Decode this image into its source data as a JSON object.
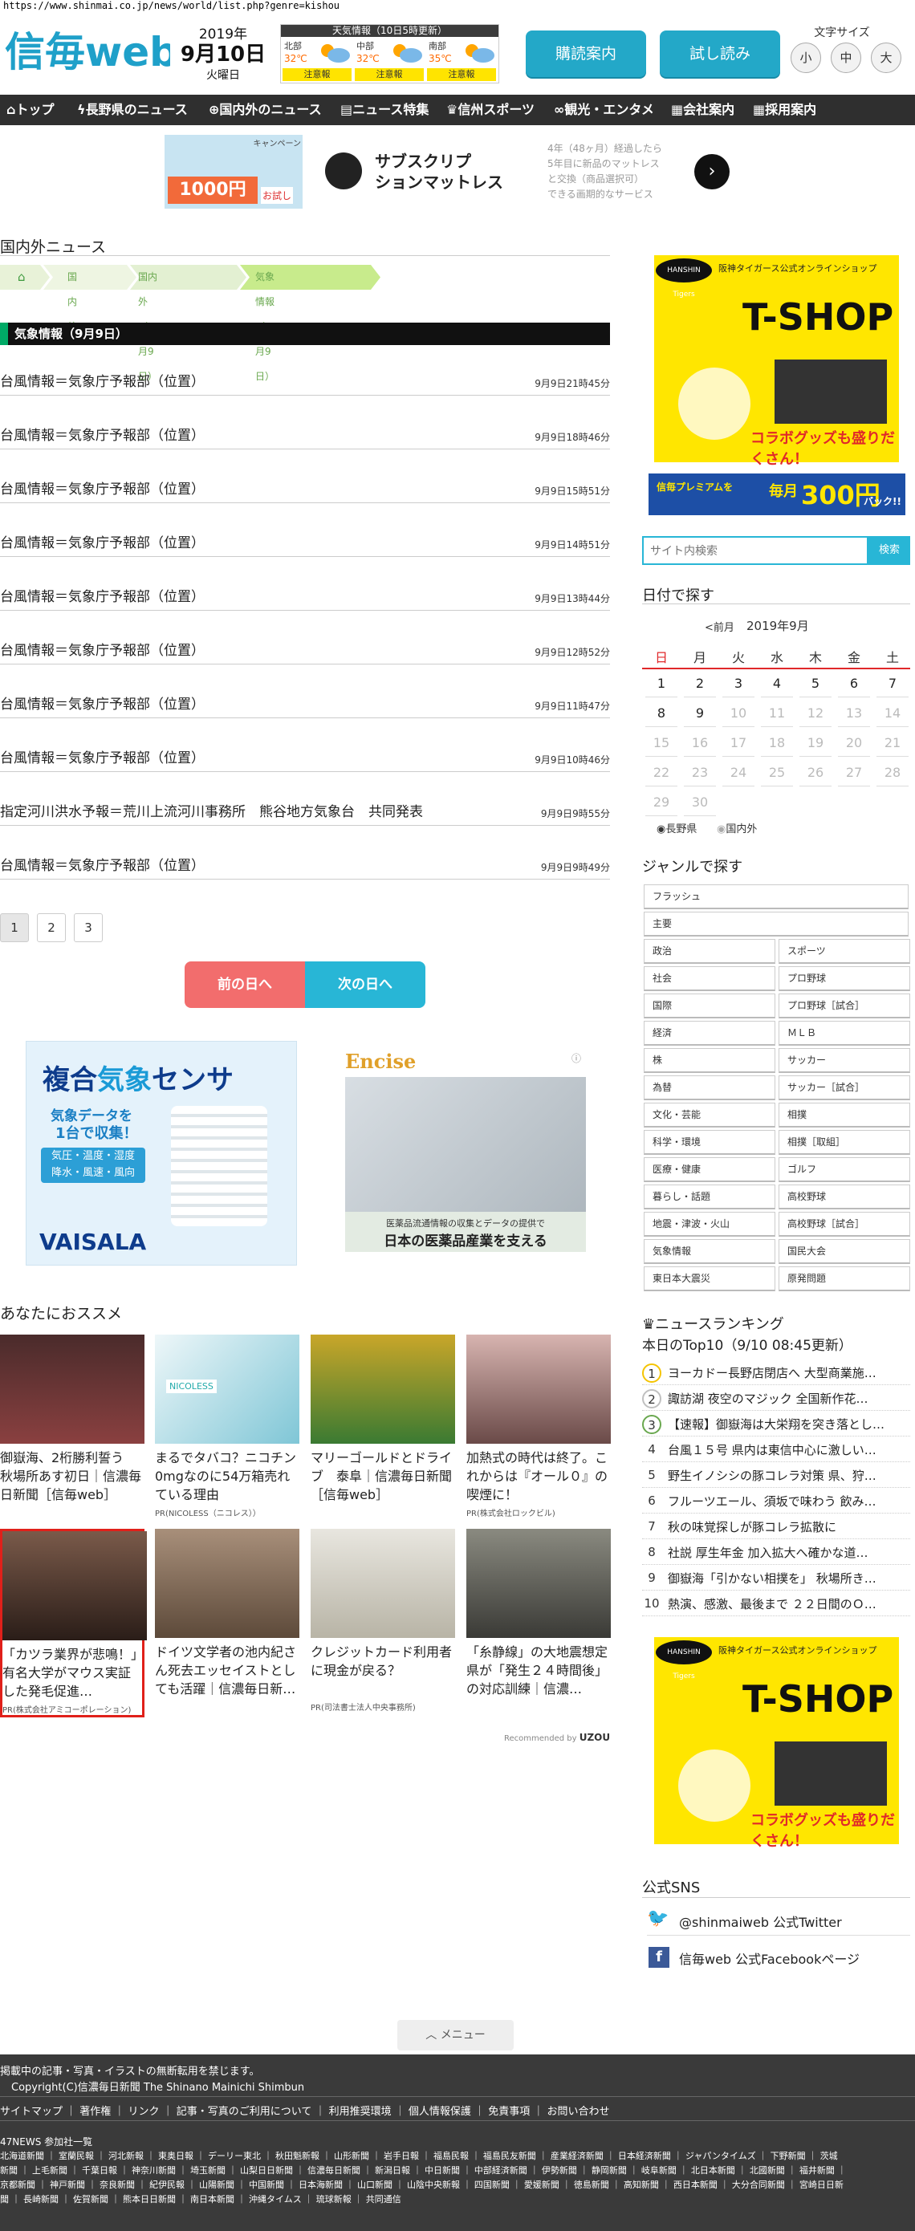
{
  "url": "https://www.shinmai.co.jp/news/world/list.php?genre=kishou",
  "header": {
    "logo_text": "信毎web",
    "date": {
      "year": "2019年",
      "month_day": "9月10日",
      "weekday": "火曜日"
    },
    "weather": {
      "title": "天気情報（10日5時更新）",
      "regions": [
        {
          "name": "北部",
          "temp": "32℃",
          "alert": "注意報"
        },
        {
          "name": "中部",
          "temp": "32℃",
          "alert": "注意報"
        },
        {
          "name": "南部",
          "temp": "35℃",
          "alert": "注意報"
        }
      ]
    },
    "subscribe_label": "購読案内",
    "trial_label": "試し読み",
    "text_size": {
      "label": "文字サイズ",
      "small": "小",
      "medium": "中",
      "large": "大"
    }
  },
  "nav": [
    "トップ",
    "長野県のニュース",
    "国内外のニュース",
    "ニュース特集",
    "信州スポーツ",
    "観光・エンタメ",
    "会社案内",
    "採用案内"
  ],
  "banner_ad": {
    "campaign": "キャンペーン",
    "price_text": "1000円",
    "price_sub": "お試し",
    "title_line1": "サブスクリプ",
    "title_line2": "ションマットレス",
    "desc": "4年（48ヶ月）経過したら\n5年目に新品のマットレス\nと交換（商品選択可）\nできる画期的なサービス"
  },
  "section_title": "国内外ニュース",
  "breadcrumb": [
    "国内外",
    "国内外（9月9日）",
    "気象情報（9月9日）"
  ],
  "list_heading": "気象情報（9月9日）",
  "news": [
    {
      "title": "台風情報＝気象庁予報部（位置）",
      "time": "9月9日21時45分"
    },
    {
      "title": "台風情報＝気象庁予報部（位置）",
      "time": "9月9日18時46分"
    },
    {
      "title": "台風情報＝気象庁予報部（位置）",
      "time": "9月9日15時51分"
    },
    {
      "title": "台風情報＝気象庁予報部（位置）",
      "time": "9月9日14時51分"
    },
    {
      "title": "台風情報＝気象庁予報部（位置）",
      "time": "9月9日13時44分"
    },
    {
      "title": "台風情報＝気象庁予報部（位置）",
      "time": "9月9日12時52分"
    },
    {
      "title": "台風情報＝気象庁予報部（位置）",
      "time": "9月9日11時47分"
    },
    {
      "title": "台風情報＝気象庁予報部（位置）",
      "time": "9月9日10時46分"
    },
    {
      "title": "指定河川洪水予報＝荒川上流河川事務所　熊谷地方気象台　共同発表",
      "time": "9月9日9時55分"
    },
    {
      "title": "台風情報＝気象庁予報部（位置）",
      "time": "9月9日9時49分"
    }
  ],
  "pagination": [
    "1",
    "2",
    "3"
  ],
  "prev_day": "前の日へ",
  "next_day": "次の日へ",
  "ad_vaisala": {
    "title_a": "複合",
    "title_b": "気象",
    "title_c": "センサ",
    "line1": "気象データを",
    "line2": "1台で収集！",
    "line3": "気圧・温度・湿度",
    "line4": "降水・風速・風向",
    "brand": "VAISALA"
  },
  "ad_encise": {
    "brand": "Encise",
    "line1": "医薬品流通情報の収集とデータの提供で",
    "line2": "日本の医薬品産業を支える"
  },
  "recommend_title": "あなたにおススメ",
  "recommend": [
    {
      "text": "御嶽海、2桁勝利誓う　秋場所あす初日｜信濃毎日新聞［信毎web］",
      "pr": ""
    },
    {
      "text": "まるでタバコ？ニコチン0mgなのに54万箱売れている理由",
      "pr": "PR(NICOLESS（ニコレス））",
      "badge": "NICOLESS"
    },
    {
      "text": "マリーゴールドとドライブ　泰阜｜信濃毎日新聞［信毎web］",
      "pr": ""
    },
    {
      "text": "加熱式の時代は終了。これからは『オール０』の喫煙に！",
      "pr": "PR(株式会社ロックビル)"
    },
    {
      "text": "「カツラ業界が悲鳴！」有名大学がマウス実証した発毛促進…",
      "pr": "PR(株式会社アミコーポレーション)"
    },
    {
      "text": "ドイツ文学者の池内紀さん死去エッセイストとしても活躍｜信濃毎日新…",
      "pr": ""
    },
    {
      "text": "クレジットカード利用者に現金が戻る？",
      "pr": "PR(司法書士法人中央事務所)"
    },
    {
      "text": "「糸静線」の大地震想定　県が「発生２４時間後」の対応訓練｜信濃…",
      "pr": ""
    }
  ],
  "recommended_by": "Recommended by",
  "recommended_brand": "UZOU",
  "right_ad": {
    "brand_small": "HANSHIN Tigers",
    "top_text": "阪神タイガース公式オンラインショップ",
    "shop": "T-SHOP",
    "bottom": "コラボグッズも盛りだくさん！"
  },
  "premium_ad": {
    "left": "信毎プレミアムを",
    "mid": "毎月",
    "price": "300円",
    "right": "バック!!"
  },
  "search": {
    "placeholder": "サイト内検索",
    "button": "検索"
  },
  "calendar": {
    "title": "日付で探す",
    "prev": "<前月",
    "month": "2019年9月",
    "weekdays": [
      "日",
      "月",
      "火",
      "水",
      "木",
      "金",
      "土"
    ],
    "days": [
      [
        "1",
        "2",
        "3",
        "4",
        "5",
        "6",
        "7"
      ],
      [
        "8",
        "9",
        "10",
        "11",
        "12",
        "13",
        "14"
      ],
      [
        "15",
        "16",
        "17",
        "18",
        "19",
        "20",
        "21"
      ],
      [
        "22",
        "23",
        "24",
        "25",
        "26",
        "27",
        "28"
      ],
      [
        "29",
        "30",
        "",
        "",
        "",
        "",
        ""
      ]
    ],
    "radio_nagano": "長野県",
    "radio_world": "国内外"
  },
  "genre": {
    "title": "ジャンルで探す",
    "full": [
      "フラッシュ",
      "主要"
    ],
    "grid": [
      [
        "政治",
        "スポーツ"
      ],
      [
        "社会",
        "プロ野球"
      ],
      [
        "国際",
        "プロ野球［試合］"
      ],
      [
        "経済",
        "ＭＬＢ"
      ],
      [
        "株",
        "サッカー"
      ],
      [
        "為替",
        "サッカー［試合］"
      ],
      [
        "文化・芸能",
        "相撲"
      ],
      [
        "科学・環境",
        "相撲［取組］"
      ],
      [
        "医療・健康",
        "ゴルフ"
      ],
      [
        "暮らし・話題",
        "高校野球"
      ],
      [
        "地震・津波・火山",
        "高校野球［試合］"
      ],
      [
        "気象情報",
        "国民大会"
      ],
      [
        "東日本大震災",
        "原発問題"
      ]
    ]
  },
  "ranking": {
    "title": "ニュースランキング",
    "subtitle": "本日のTop10（9/10 08:45更新）",
    "items": [
      "ヨーカドー長野店閉店へ 大型商業施…",
      "諏訪湖 夜空のマジック 全国新作花…",
      "【速報】御嶽海は大栄翔を突き落とし…",
      "台風１５号 県内は東信中心に激しい…",
      "野生イノシシの豚コレラ対策 県、狩…",
      "フルーツエール、須坂で味わう 飲み…",
      "秋の味覚探しが豚コレラ拡散に",
      "社説 厚生年金 加入拡大へ確かな道…",
      "御嶽海「引かない相撲を」 秋場所き…",
      "熱演、感激、最後まで ２２日間のＯ…"
    ]
  },
  "sns": {
    "title": "公式SNS",
    "twitter": "@shinmaiweb 公式Twitter",
    "facebook": "信毎web 公式Facebookページ"
  },
  "menu_label": "メニュー",
  "footer": {
    "notice": "掲載中の記事・写真・イラストの無断転用を禁じます。",
    "copyright": "Copyright(C)信濃毎日新聞 The Shinano Mainichi Shimbun",
    "links": "サイトマップ ｜ 著作権 ｜ リンク ｜ 記事・写真のご利用について ｜ 利用推奨環境 ｜ 個人情報保護 ｜ 免責事項 ｜ お問い合わせ",
    "members_title": "47NEWS 参加社一覧",
    "members1": "北海道新聞 ｜ 室蘭民報 ｜ 河北新報 ｜ 東奥日報 ｜ デーリー東北 ｜ 秋田魁新報 ｜ 山形新聞 ｜ 岩手日報 ｜ 福島民報 ｜ 福島民友新聞 ｜ 産業経済新聞 ｜ 日本経済新聞 ｜ ジャパンタイムズ ｜ 下野新聞 ｜ 茨城",
    "members2": "新聞 ｜ 上毛新聞 ｜ 千葉日報 ｜ 神奈川新聞 ｜ 埼玉新聞 ｜ 山梨日日新聞 ｜ 信濃毎日新聞 ｜ 新潟日報 ｜ 中日新聞 ｜ 中部経済新聞 ｜ 伊勢新聞 ｜ 静岡新聞 ｜ 岐阜新聞 ｜ 北日本新聞 ｜ 北國新聞 ｜ 福井新聞 ｜",
    "members3": "京都新聞 ｜ 神戸新聞 ｜ 奈良新聞 ｜ 紀伊民報 ｜ 山陽新聞 ｜ 中国新聞 ｜ 日本海新聞 ｜ 山口新聞 ｜ 山陰中央新報 ｜ 四国新聞 ｜ 愛媛新聞 ｜ 徳島新聞 ｜ 高知新聞 ｜ 西日本新聞 ｜ 大分合同新聞 ｜ 宮崎日日新",
    "members4": "聞 ｜ 長崎新聞 ｜ 佐賀新聞 ｜ 熊本日日新聞 ｜ 南日本新聞 ｜ 沖縄タイムス ｜ 琉球新報 ｜ 共同通信"
  },
  "colors": {
    "accent": "#23a8c8",
    "green": "#00aa66",
    "prev": "#f26d6d",
    "next": "#28b6d6",
    "footer": "#3a3a3a"
  }
}
